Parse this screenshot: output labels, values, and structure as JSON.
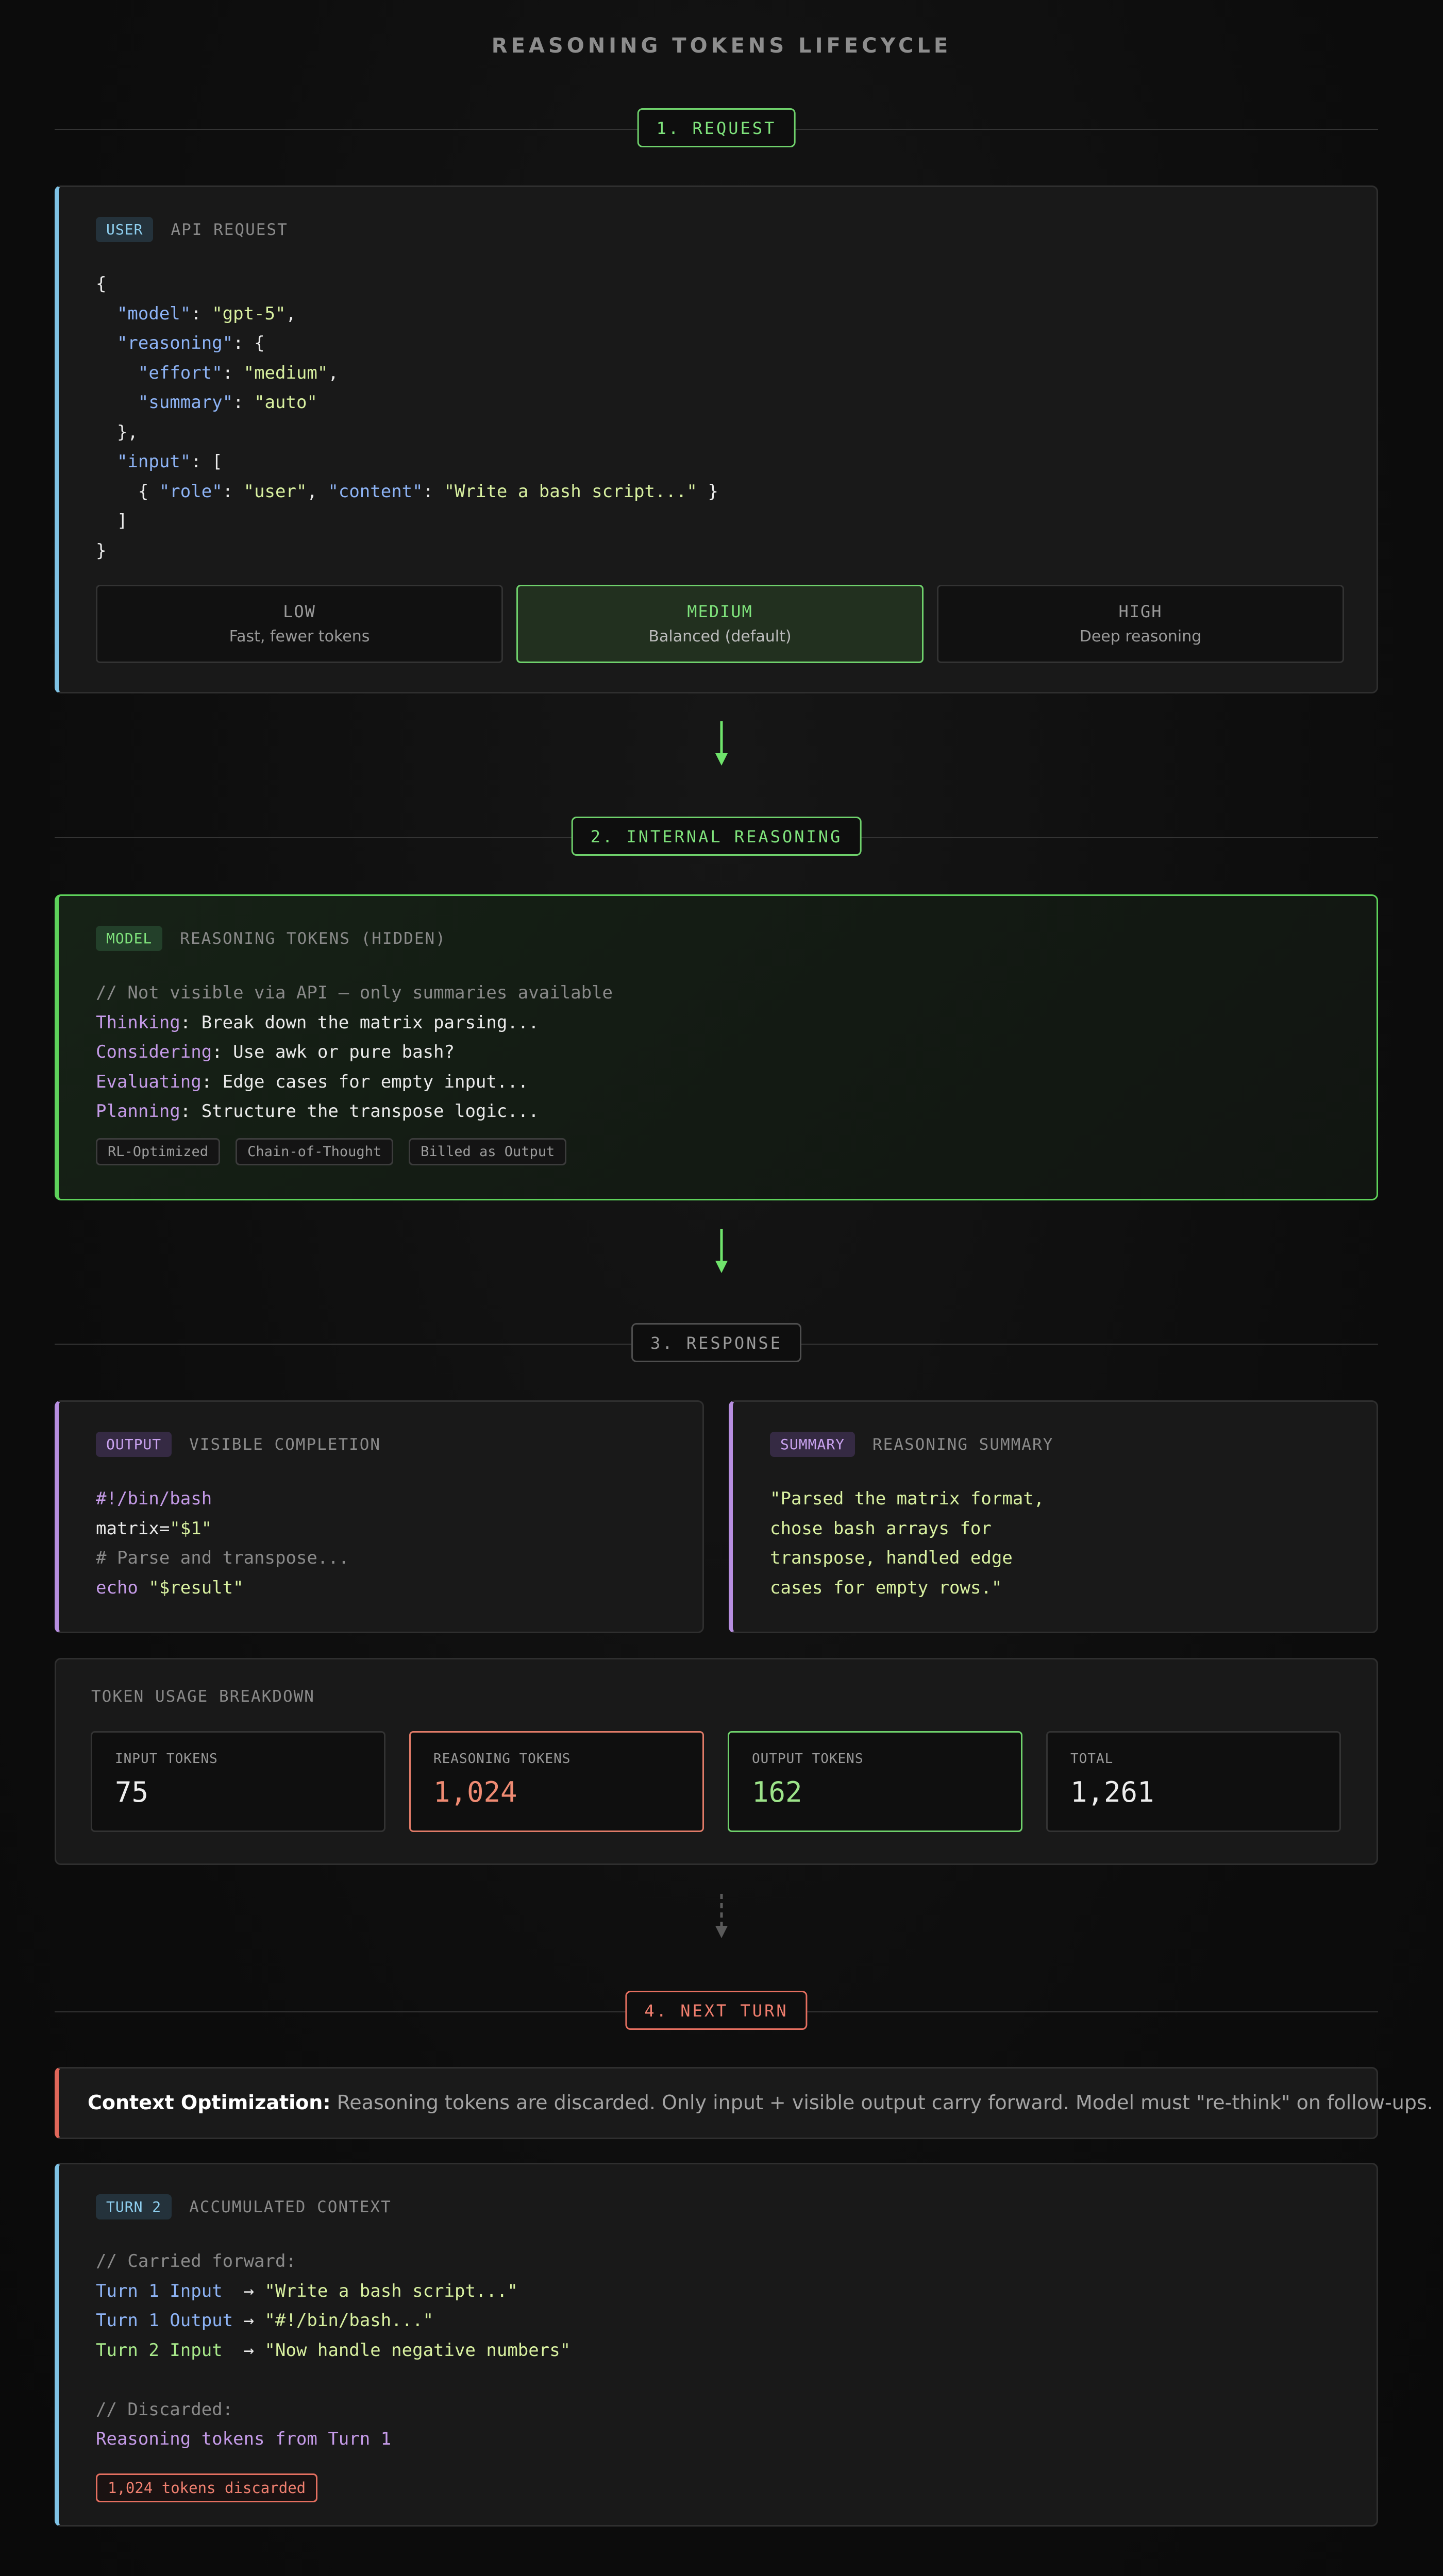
{
  "title": "REASONING TOKENS LIFECYCLE",
  "sections": {
    "request": "1. REQUEST",
    "reasoning": "2. INTERNAL REASONING",
    "response": "3. RESPONSE",
    "next": "4. NEXT TURN"
  },
  "request_card": {
    "tag": "USER",
    "label": "API REQUEST",
    "code": {
      "open": "{",
      "model_key": "\"model\"",
      "model_val": "\"gpt-5\"",
      "reasoning_key": "\"reasoning\"",
      "effort_key": "\"effort\"",
      "effort_val": "\"medium\"",
      "summary_key": "\"summary\"",
      "summary_val": "\"auto\"",
      "input_key": "\"input\"",
      "role_key": "\"role\"",
      "role_val": "\"user\"",
      "content_key": "\"content\"",
      "content_val": "\"Write a bash script...\"",
      "close": "}"
    },
    "efforts": [
      {
        "level": "LOW",
        "desc": "Fast, fewer tokens"
      },
      {
        "level": "MEDIUM",
        "desc": "Balanced (default)"
      },
      {
        "level": "HIGH",
        "desc": "Deep reasoning"
      }
    ]
  },
  "reasoning_card": {
    "tag": "MODEL",
    "label": "REASONING TOKENS (HIDDEN)",
    "comment": "// Not visible via API — only summaries available",
    "steps": [
      {
        "verb": "Thinking",
        "text": ": Break down the matrix parsing..."
      },
      {
        "verb": "Considering",
        "text": ": Use awk or pure bash?"
      },
      {
        "verb": "Evaluating",
        "text": ": Edge cases for empty input..."
      },
      {
        "verb": "Planning",
        "text": ": Structure the transpose logic..."
      }
    ],
    "chips": [
      "RL-Optimized",
      "Chain-of-Thought",
      "Billed as Output"
    ]
  },
  "output_card": {
    "tag": "OUTPUT",
    "label": "VISIBLE COMPLETION",
    "line1": "#!/bin/bash",
    "line2_var": "matrix=",
    "line2_val": "\"$1\"",
    "line3": "# Parse and transpose...",
    "line4_cmd": "echo",
    "line4_val": "\"$result\""
  },
  "summary_card": {
    "tag": "SUMMARY",
    "label": "REASONING SUMMARY",
    "lines": [
      "\"Parsed the matrix format,",
      "chose bash arrays for",
      "transpose, handled edge",
      "cases for empty rows.\""
    ]
  },
  "usage": {
    "heading": "TOKEN USAGE BREAKDOWN",
    "stats": [
      {
        "label": "INPUT TOKENS",
        "value": "75"
      },
      {
        "label": "REASONING TOKENS",
        "value": "1,024"
      },
      {
        "label": "OUTPUT TOKENS",
        "value": "162"
      },
      {
        "label": "TOTAL",
        "value": "1,261"
      }
    ]
  },
  "note": {
    "bold": "Context Optimization:",
    "text": " Reasoning tokens are discarded. Only input + visible output carry forward. Model must \"re-think\" on follow-ups."
  },
  "turn2_card": {
    "tag": "TURN 2",
    "label": "ACCUMULATED CONTEXT",
    "carried_comment": "// Carried forward:",
    "carried": [
      {
        "key": "Turn 1 Input ",
        "val": "\"Write a bash script...\""
      },
      {
        "key": "Turn 1 Output",
        "val": "\"#!/bin/bash...\""
      },
      {
        "key": "Turn 2 Input ",
        "val": "\"Now handle negative numbers\""
      }
    ],
    "arrow": " → ",
    "discarded_comment": "// Discarded:",
    "discarded": "Reasoning tokens from Turn 1",
    "discard_badge": "1,024 tokens discarded"
  },
  "colors": {
    "green": "#6fd16c",
    "blue": "#7fc3e6",
    "purple": "#b78ee0",
    "red": "#e0675a"
  }
}
